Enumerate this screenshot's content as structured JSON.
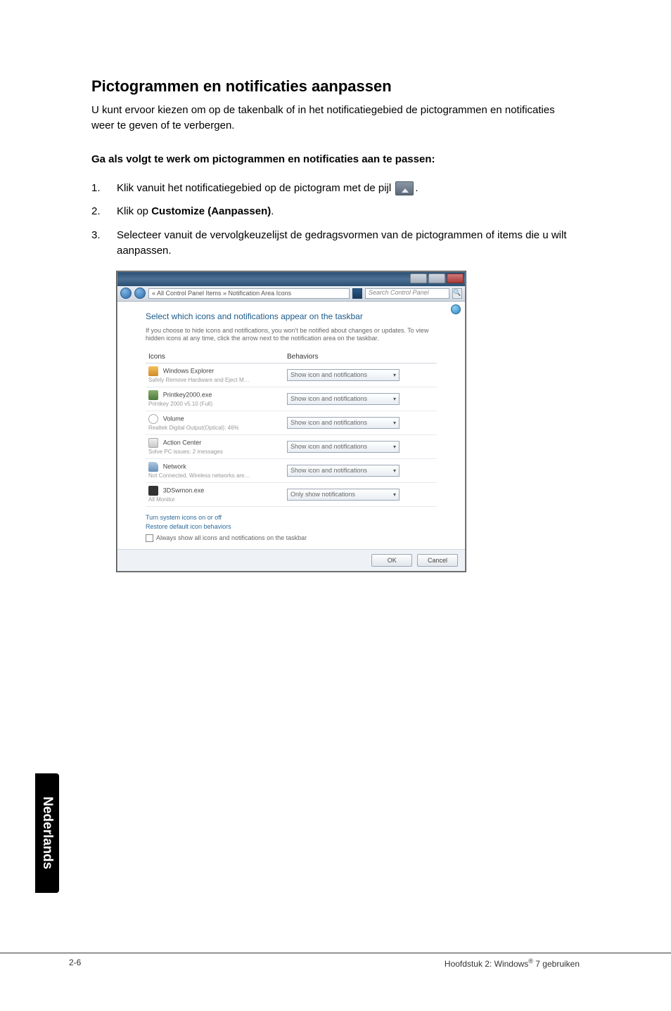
{
  "page": {
    "heading": "Pictogrammen en notificaties aanpassen",
    "intro": "U kunt ervoor kiezen om op de takenbalk of in het notificatiegebied de pictogrammen en notificaties weer te geven of te verbergen.",
    "subhead": "Ga als volgt te werk om pictogrammen en notificaties aan te passen:",
    "step1_a": "Klik vanuit het notificatiegebied op de pictogram met de pijl ",
    "step1_b": ".",
    "step2_a": "Klik op ",
    "step2_b": "Customize (Aanpassen)",
    "step2_c": ".",
    "step3": "Selecteer vanuit de vervolgkeuzelijst de gedragsvormen van de pictogrammen of items die u wilt aanpassen."
  },
  "window": {
    "breadcrumb": "« All Control Panel Items » Notification Area Icons",
    "search_placeholder": "Search Control Panel",
    "heading": "Select which icons and notifications appear on the taskbar",
    "desc": "If you choose to hide icons and notifications, you won't be notified about changes or updates. To view hidden icons at any time, click the arrow next to the notification area on the taskbar.",
    "col_icons": "Icons",
    "col_behaviors": "Behaviors",
    "items": [
      {
        "name": "Windows Explorer",
        "sub": "Safely Remove Hardware and Eject M…",
        "behavior": "Show icon and notifications"
      },
      {
        "name": "Printkey2000.exe",
        "sub": "Printkey 2000 v5.10 (Full)",
        "behavior": "Show icon and notifications"
      },
      {
        "name": "Volume",
        "sub": "Realtek Digital Output(Optical): 46%",
        "behavior": "Show icon and notifications"
      },
      {
        "name": "Action Center",
        "sub": "Solve PC issues: 2 messages",
        "behavior": "Show icon and notifications"
      },
      {
        "name": "Network",
        "sub": "Not Connected. Wireless networks are…",
        "behavior": "Show icon and notifications"
      },
      {
        "name": "3DSwmon.exe",
        "sub": "All Monitor",
        "behavior": "Only show notifications"
      }
    ],
    "link1": "Turn system icons on or off",
    "link2": "Restore default icon behaviors",
    "checkbox_label": "Always show all icons and notifications on the taskbar",
    "ok": "OK",
    "cancel": "Cancel"
  },
  "sideTab": "Nederlands",
  "footer": {
    "left": "2-6",
    "right_a": "Hoofdstuk 2: Windows",
    "right_b": " 7 gebruiken"
  }
}
